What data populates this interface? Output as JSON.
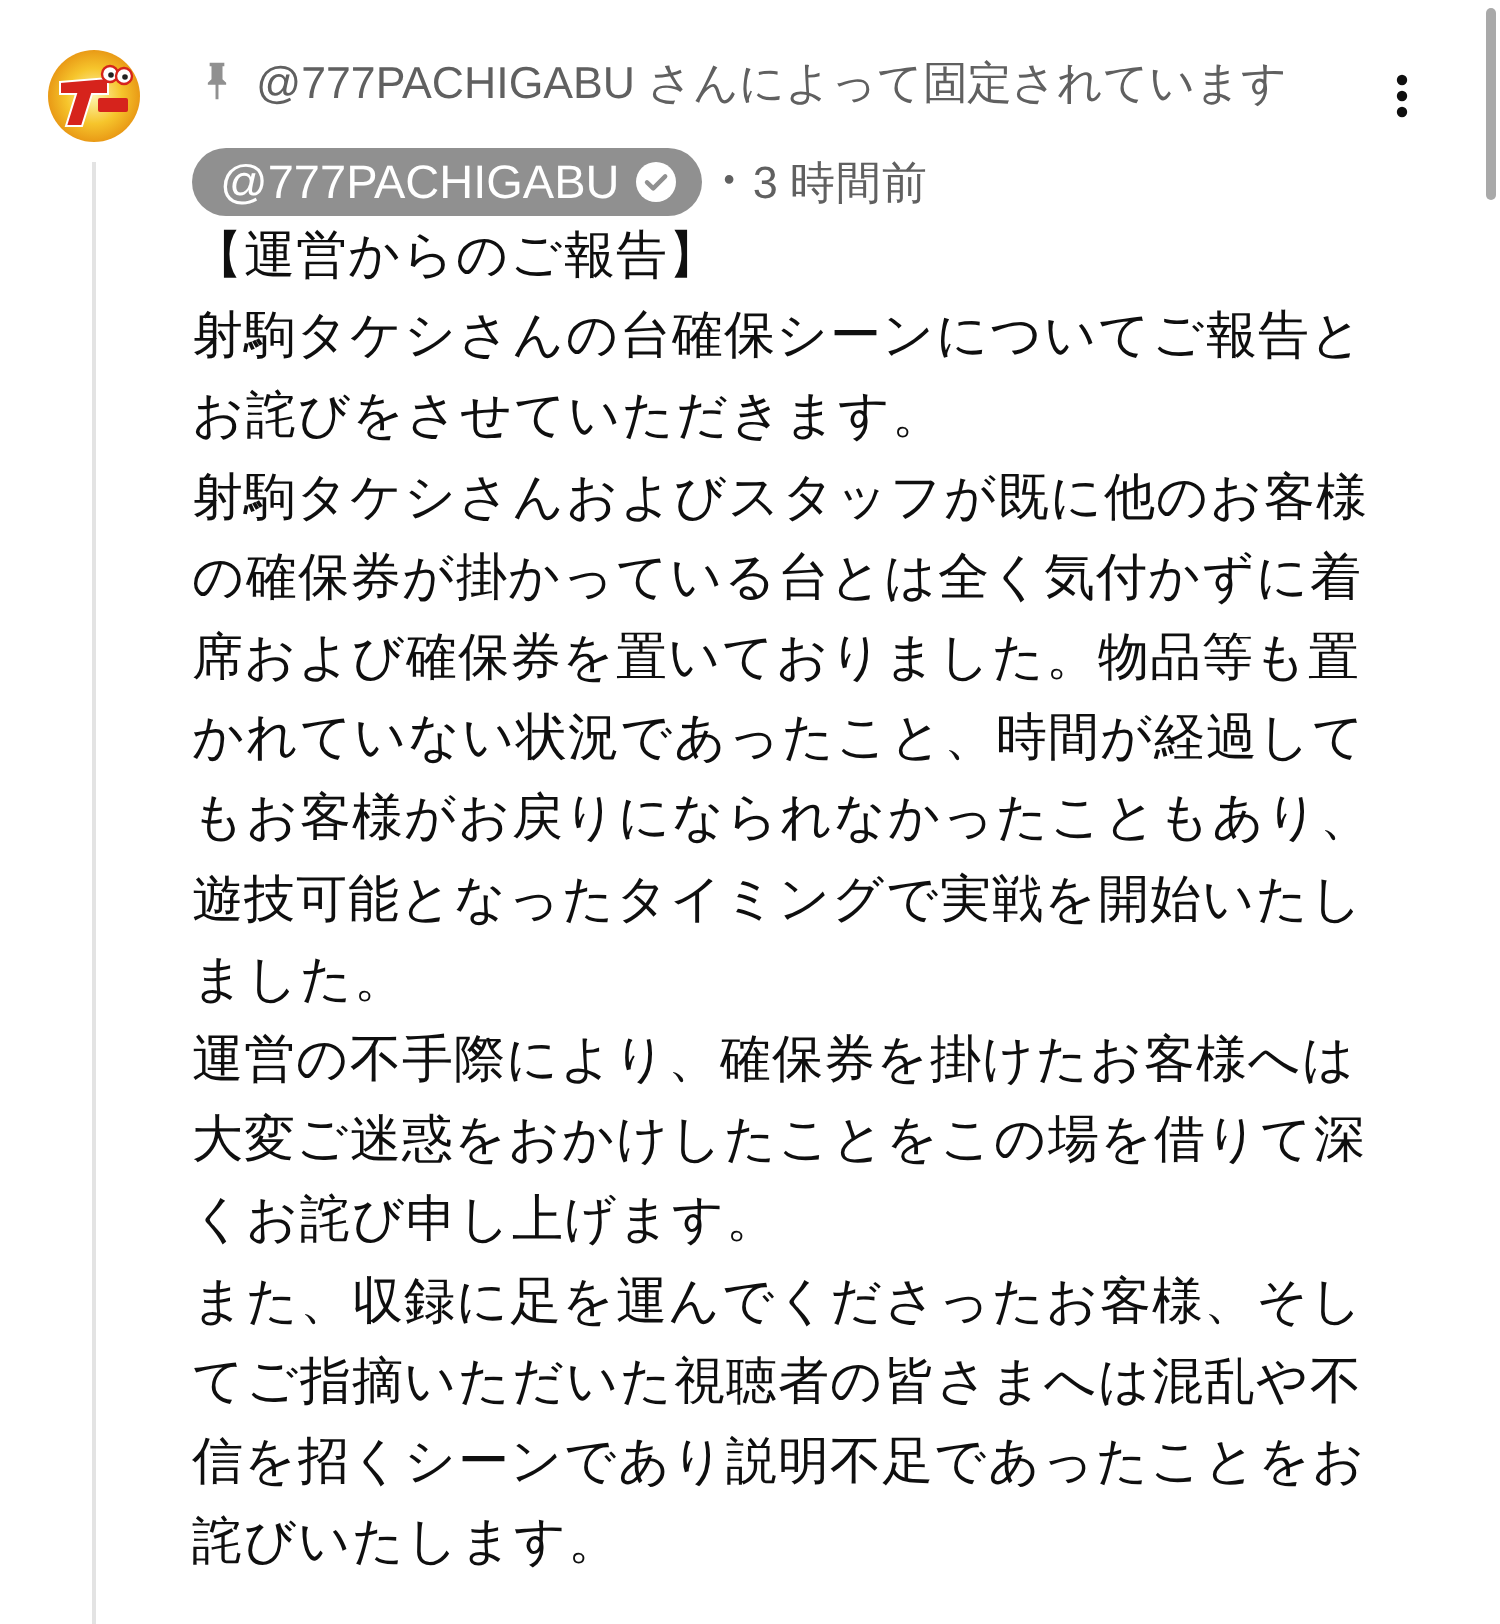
{
  "pinned_notice": "@777PACHIGABU さんによって固定されています",
  "author": {
    "handle": "@777PACHIGABU",
    "verified": true
  },
  "separator": "•",
  "timestamp": "3 時間前",
  "comment": {
    "paragraphs": [
      "【運営からのご報告】",
      "射駒タケシさんの台確保シーンについてご報告とお詫びをさせていただきます。",
      "射駒タケシさんおよびスタッフが既に他のお客様の確保券が掛かっている台とは全く気付かずに着席および確保券を置いておりました。物品等も置かれていない状況であったこと、時間が経過してもお客様がお戻りになられなかったこともあり、遊技可能となったタイミングで実戦を開始いたしました。",
      "運営の不手際により、確保券を掛けたお客様へは大変ご迷惑をおかけしたことをこの場を借りて深くお詫び申し上げます。",
      "また、収録に足を運んでくださったお客様、そしてご指摘いただいた視聴者の皆さまへは混乱や不信を招くシーンであり説明不足であったことをお詫びいたします。"
    ]
  }
}
